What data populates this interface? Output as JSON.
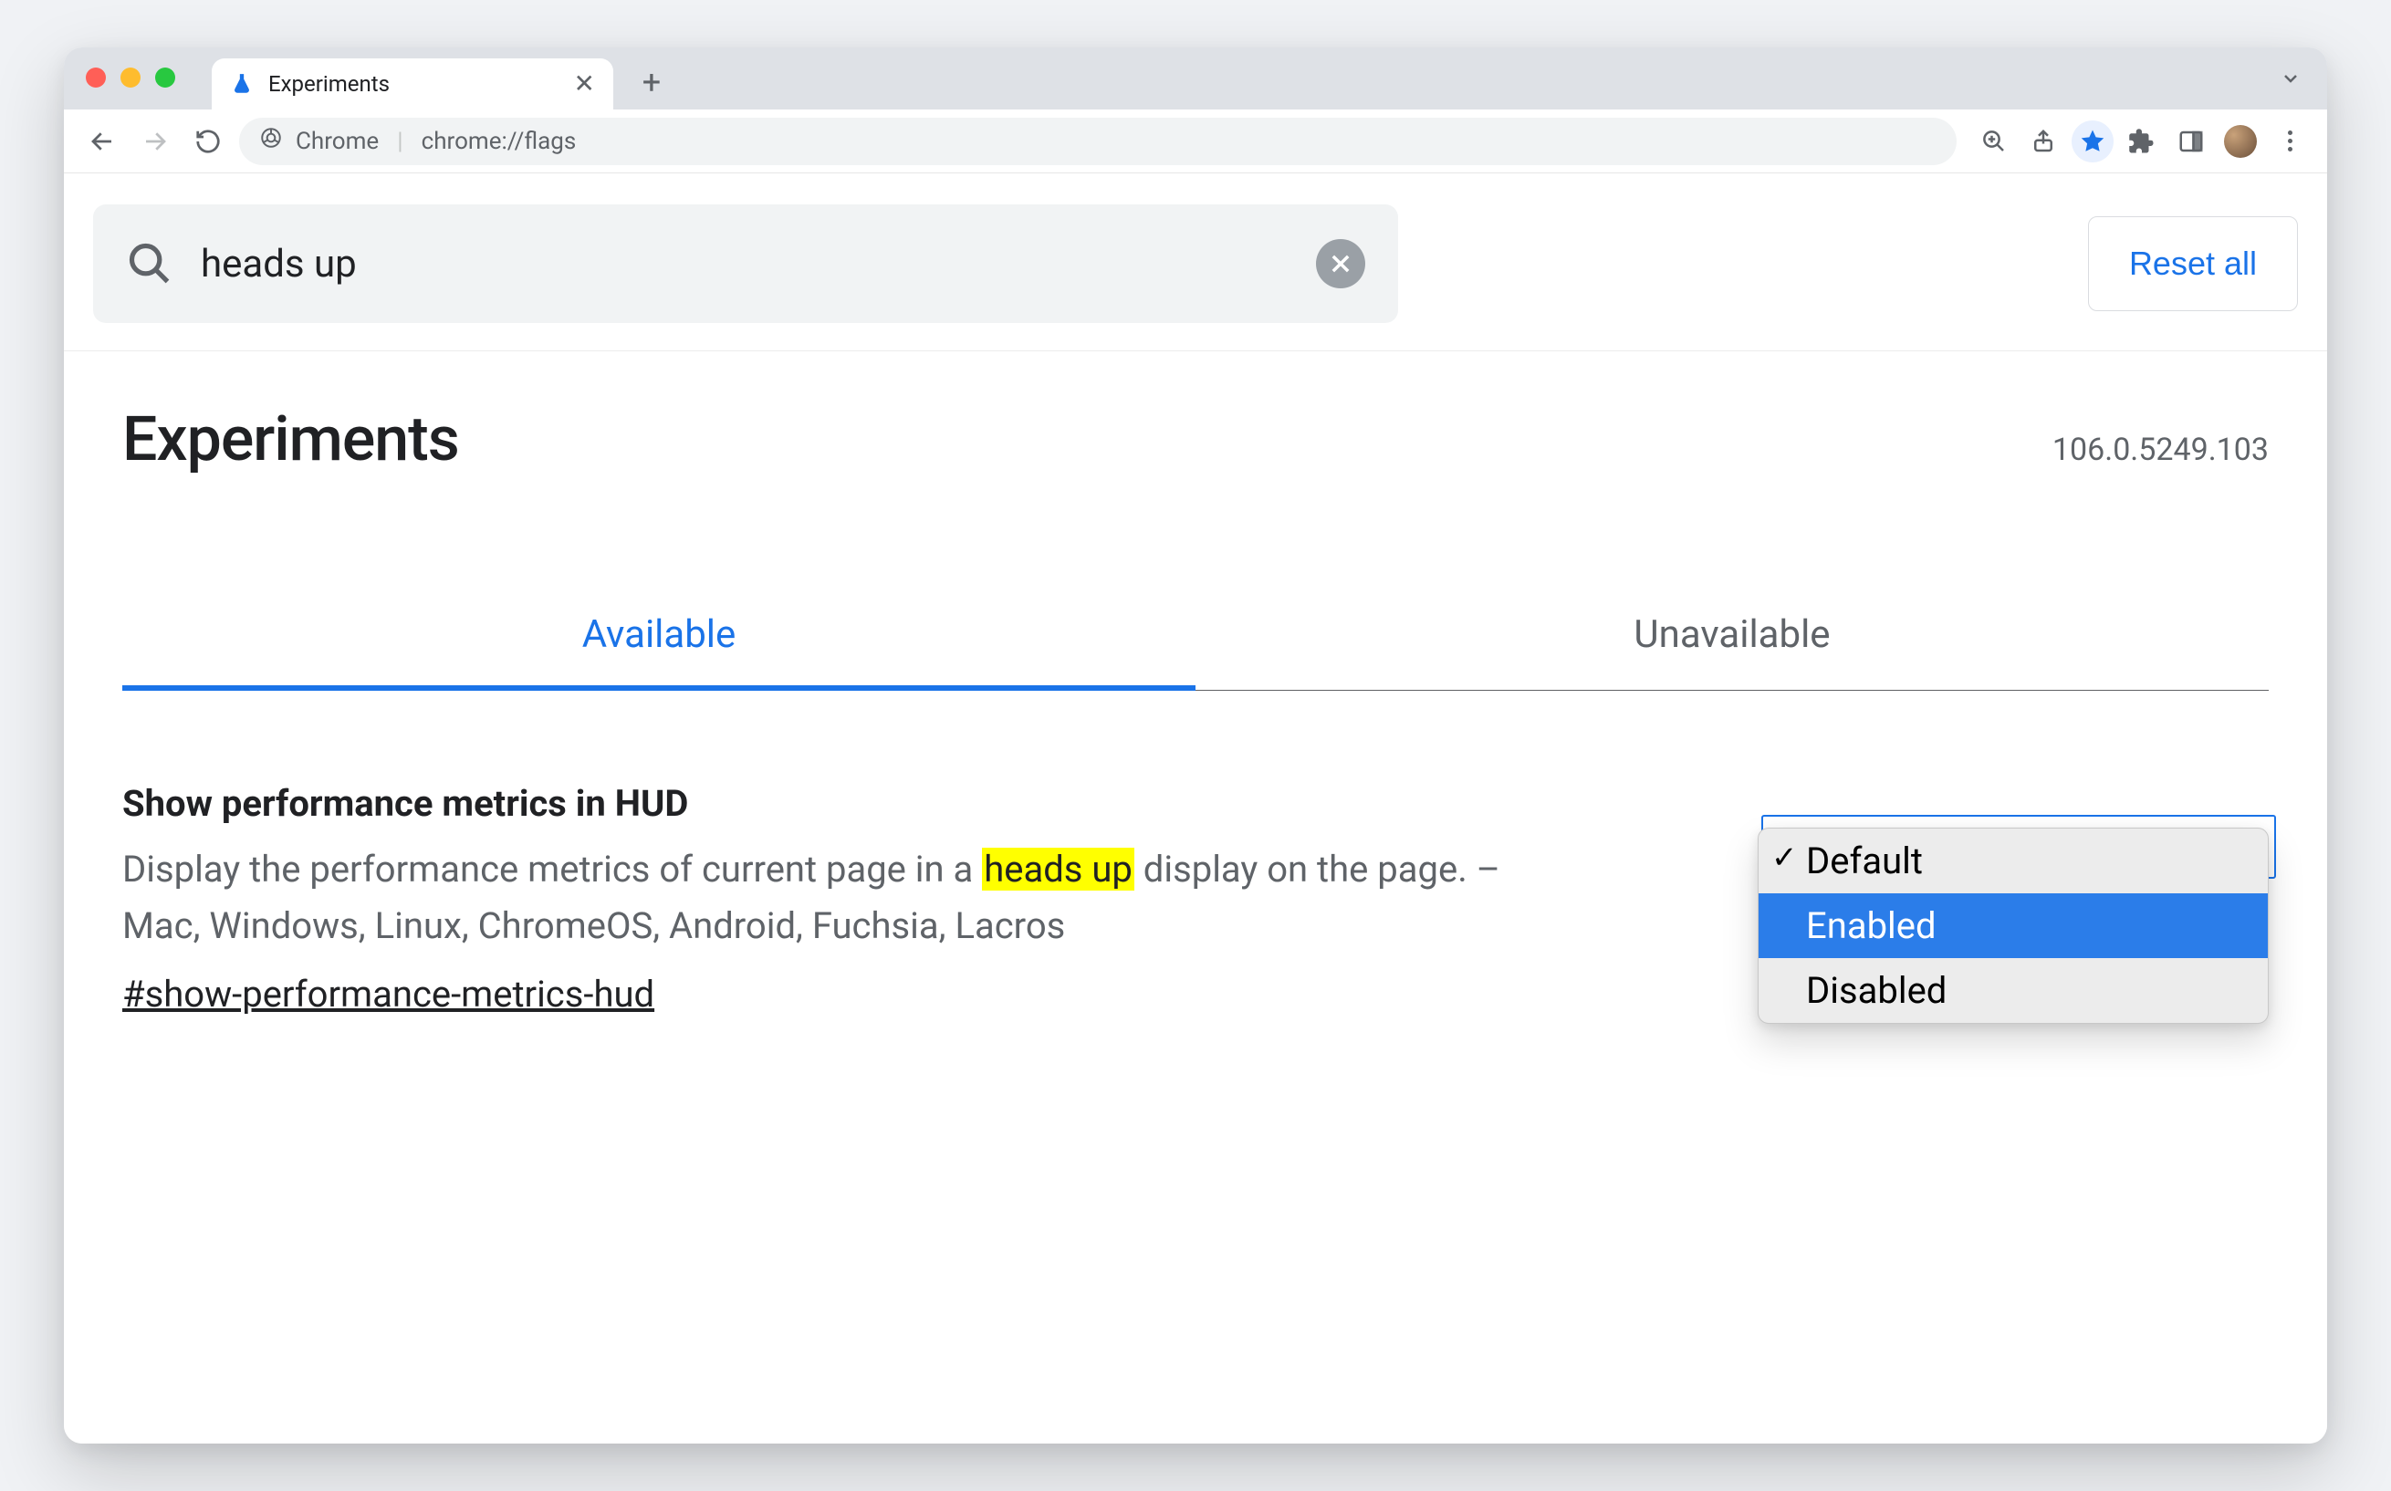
{
  "browser": {
    "tab_title": "Experiments",
    "url_scheme_label": "Chrome",
    "url_path": "chrome://flags"
  },
  "search": {
    "value": "heads up",
    "reset_label": "Reset all"
  },
  "page": {
    "heading": "Experiments",
    "version": "106.0.5249.103"
  },
  "tabs": {
    "available": "Available",
    "unavailable": "Unavailable"
  },
  "flag": {
    "title": "Show performance metrics in HUD",
    "desc_before": "Display the performance metrics of current page in a ",
    "desc_highlight": "heads up",
    "desc_after": " display on the page. – Mac, Windows, Linux, ChromeOS, Android, Fuchsia, Lacros",
    "anchor": "#show-performance-metrics-hud"
  },
  "dropdown": {
    "options": {
      "default": "Default",
      "enabled": "Enabled",
      "disabled": "Disabled"
    }
  }
}
